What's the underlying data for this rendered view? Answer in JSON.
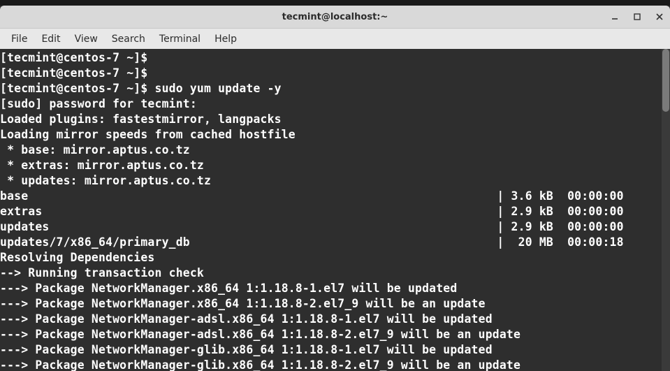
{
  "window": {
    "title": "tecmint@localhost:~"
  },
  "menubar": {
    "items": [
      "File",
      "Edit",
      "View",
      "Search",
      "Terminal",
      "Help"
    ]
  },
  "terminal": {
    "prompt": "[tecmint@centos-7 ~]$ ",
    "command": "sudo yum update -y",
    "sudo_prompt": "[sudo] password for tecmint: ",
    "plugins_line": "Loaded plugins: fastestmirror, langpacks",
    "mirror_line": "Loading mirror speeds from cached hostfile",
    "mirrors": [
      " * base: mirror.aptus.co.tz",
      " * extras: mirror.aptus.co.tz",
      " * updates: mirror.aptus.co.tz"
    ],
    "repos": [
      {
        "name": "base",
        "sep": "| 3.6 kB  00:00:00     "
      },
      {
        "name": "extras",
        "sep": "| 2.9 kB  00:00:00     "
      },
      {
        "name": "updates",
        "sep": "| 2.9 kB  00:00:00     "
      },
      {
        "name": "updates/7/x86_64/primary_db",
        "sep": "|  20 MB  00:00:18     "
      }
    ],
    "resolving": "Resolving Dependencies",
    "trans_check": "--> Running transaction check",
    "packages": [
      "---> Package NetworkManager.x86_64 1:1.18.8-1.el7 will be updated",
      "---> Package NetworkManager.x86_64 1:1.18.8-2.el7_9 will be an update",
      "---> Package NetworkManager-adsl.x86_64 1:1.18.8-1.el7 will be updated",
      "---> Package NetworkManager-adsl.x86_64 1:1.18.8-2.el7_9 will be an update",
      "---> Package NetworkManager-glib.x86_64 1:1.18.8-1.el7 will be updated",
      "---> Package NetworkManager-glib.x86_64 1:1.18.8-2.el7_9 will be an update"
    ]
  }
}
